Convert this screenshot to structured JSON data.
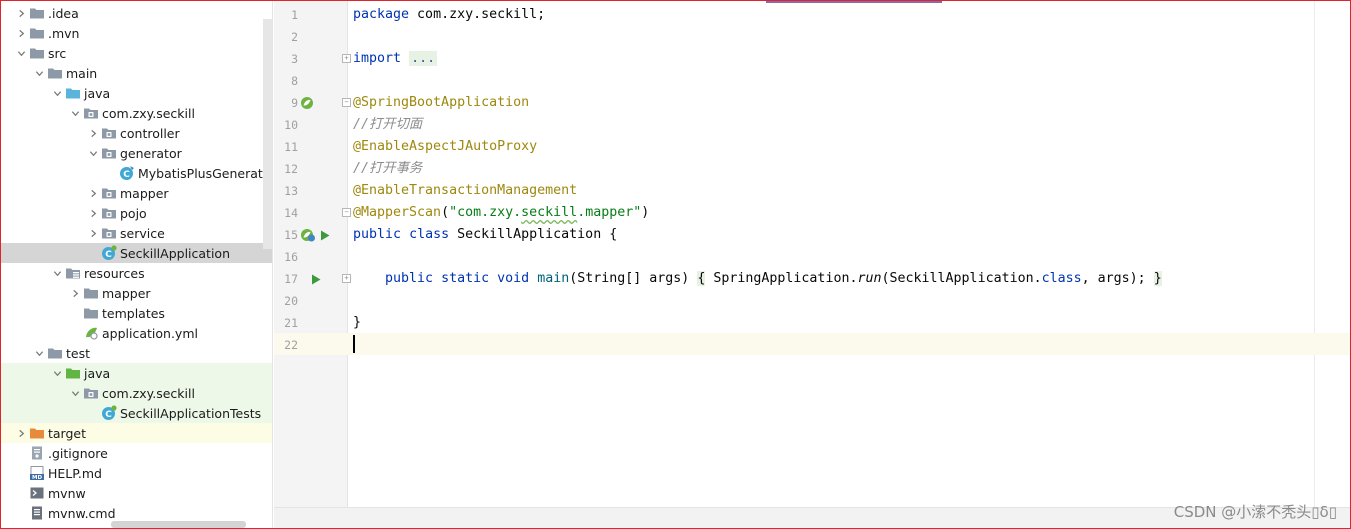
{
  "tree": {
    "items": [
      {
        "label": ".idea",
        "icon": "folder-icon",
        "chevron": "right"
      },
      {
        "label": ".mvn",
        "icon": "folder-icon",
        "chevron": "right"
      },
      {
        "label": "src",
        "icon": "folder-icon",
        "chevron": "down"
      },
      {
        "label": "main",
        "icon": "folder-icon",
        "chevron": "down"
      },
      {
        "label": "java",
        "icon": "source-folder-icon",
        "chevron": "down"
      },
      {
        "label": "com.zxy.seckill",
        "icon": "package-icon",
        "chevron": "down"
      },
      {
        "label": "controller",
        "icon": "package-icon",
        "chevron": "right"
      },
      {
        "label": "generator",
        "icon": "package-icon",
        "chevron": "down"
      },
      {
        "label": "MybatisPlusGenerator",
        "icon": "java-class-icon",
        "chevron": "none"
      },
      {
        "label": "mapper",
        "icon": "package-icon",
        "chevron": "right"
      },
      {
        "label": "pojo",
        "icon": "package-icon",
        "chevron": "right"
      },
      {
        "label": "service",
        "icon": "package-icon",
        "chevron": "right"
      },
      {
        "label": "SeckillApplication",
        "icon": "spring-class-icon",
        "chevron": "none",
        "selected": true
      },
      {
        "label": "resources",
        "icon": "resources-folder-icon",
        "chevron": "down"
      },
      {
        "label": "mapper",
        "icon": "folder-icon",
        "chevron": "right"
      },
      {
        "label": "templates",
        "icon": "folder-icon",
        "chevron": "none"
      },
      {
        "label": "application.yml",
        "icon": "yml-file-icon",
        "chevron": "none"
      },
      {
        "label": "test",
        "icon": "folder-icon",
        "chevron": "down"
      },
      {
        "label": "java",
        "icon": "test-folder-icon",
        "chevron": "down",
        "test": true
      },
      {
        "label": "com.zxy.seckill",
        "icon": "package-icon",
        "chevron": "down",
        "test": true
      },
      {
        "label": "SeckillApplicationTests",
        "icon": "test-class-icon",
        "chevron": "none",
        "test": true
      },
      {
        "label": "target",
        "icon": "excluded-folder-icon",
        "chevron": "right",
        "target": true
      },
      {
        "label": ".gitignore",
        "icon": "gitignore-file-icon",
        "chevron": "none"
      },
      {
        "label": "HELP.md",
        "icon": "markdown-file-icon",
        "chevron": "none"
      },
      {
        "label": "mvnw",
        "icon": "shell-file-icon",
        "chevron": "none"
      },
      {
        "label": "mvnw.cmd",
        "icon": "text-file-icon",
        "chevron": "none"
      }
    ]
  },
  "editor": {
    "line_numbers": [
      "1",
      "2",
      "3",
      "8",
      "9",
      "10",
      "11",
      "12",
      "13",
      "14",
      "15",
      "16",
      "17",
      "20",
      "21",
      "22"
    ],
    "code": {
      "l1_kw": "package",
      "l1_rest": " com.zxy.seckill;",
      "l3_kw": "import",
      "l3_fold": "...",
      "l9": "@SpringBootApplication",
      "l10": "//打开切面",
      "l11": "@EnableAspectJAutoProxy",
      "l12": "//打开事务",
      "l13": "@EnableTransactionManagement",
      "l14_ann": "@MapperScan",
      "l14_open": "(",
      "l14_str_a": "\"com.zxy.",
      "l14_str_b": "seckill",
      "l14_str_c": ".mapper\"",
      "l14_close": ")",
      "l15_public": "public",
      "l15_class": "class",
      "l15_rest": " SeckillApplication {",
      "l17_indent": "    ",
      "l17_public": "public",
      "l17_static": "static",
      "l17_void": "void",
      "l17_main": "main",
      "l17_params": "(String[] args)",
      "l17_ob": "{",
      "l17_body_a": " SpringApplication.",
      "l17_run": "run",
      "l17_body_b": "(SeckillApplication.",
      "l17_classkw": "class",
      "l17_body_c": ", args); ",
      "l17_cb": "}",
      "l21": "}"
    }
  },
  "watermark": "CSDN @小溹不秃头▯δ▯",
  "colors": {
    "keyword": "#0033b3",
    "annotation": "#9e880d",
    "comment": "#8c8c8c",
    "string": "#067d17",
    "frame": "#e0242c"
  }
}
